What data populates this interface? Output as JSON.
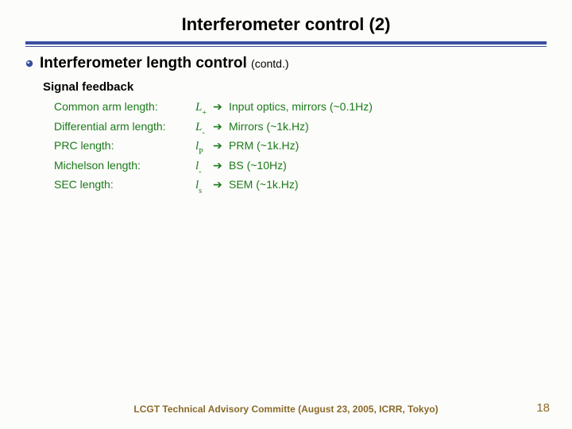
{
  "title": "Interferometer control (2)",
  "section": {
    "heading": "Interferometer length control",
    "annotation": "(contd.)"
  },
  "sub_heading": "Signal feedback",
  "rows": [
    {
      "label": "Common arm length:",
      "symMain": "L",
      "symSub": "+",
      "arrow": "➔",
      "dest": "Input optics, mirrors (~0.1Hz)"
    },
    {
      "label": "Differential arm length:",
      "symMain": "L",
      "symSub": "-",
      "arrow": "➔",
      "dest": "Mirrors (~1k.Hz)"
    },
    {
      "label": "PRC length:",
      "symMain": "l",
      "symSub": "P",
      "arrow": "➔",
      "dest": "PRM (~1k.Hz)"
    },
    {
      "label": "Michelson length:",
      "symMain": "l",
      "symSub": "-",
      "arrow": "➔",
      "dest": "BS (~10Hz)"
    },
    {
      "label": "SEC length:",
      "symMain": "l",
      "symSub": "s",
      "arrow": "➔",
      "dest": "SEM (~1k.Hz)"
    }
  ],
  "footer": "LCGT  Technical Advisory Committe (August 23, 2005, ICRR, Tokyo)",
  "page": "18"
}
